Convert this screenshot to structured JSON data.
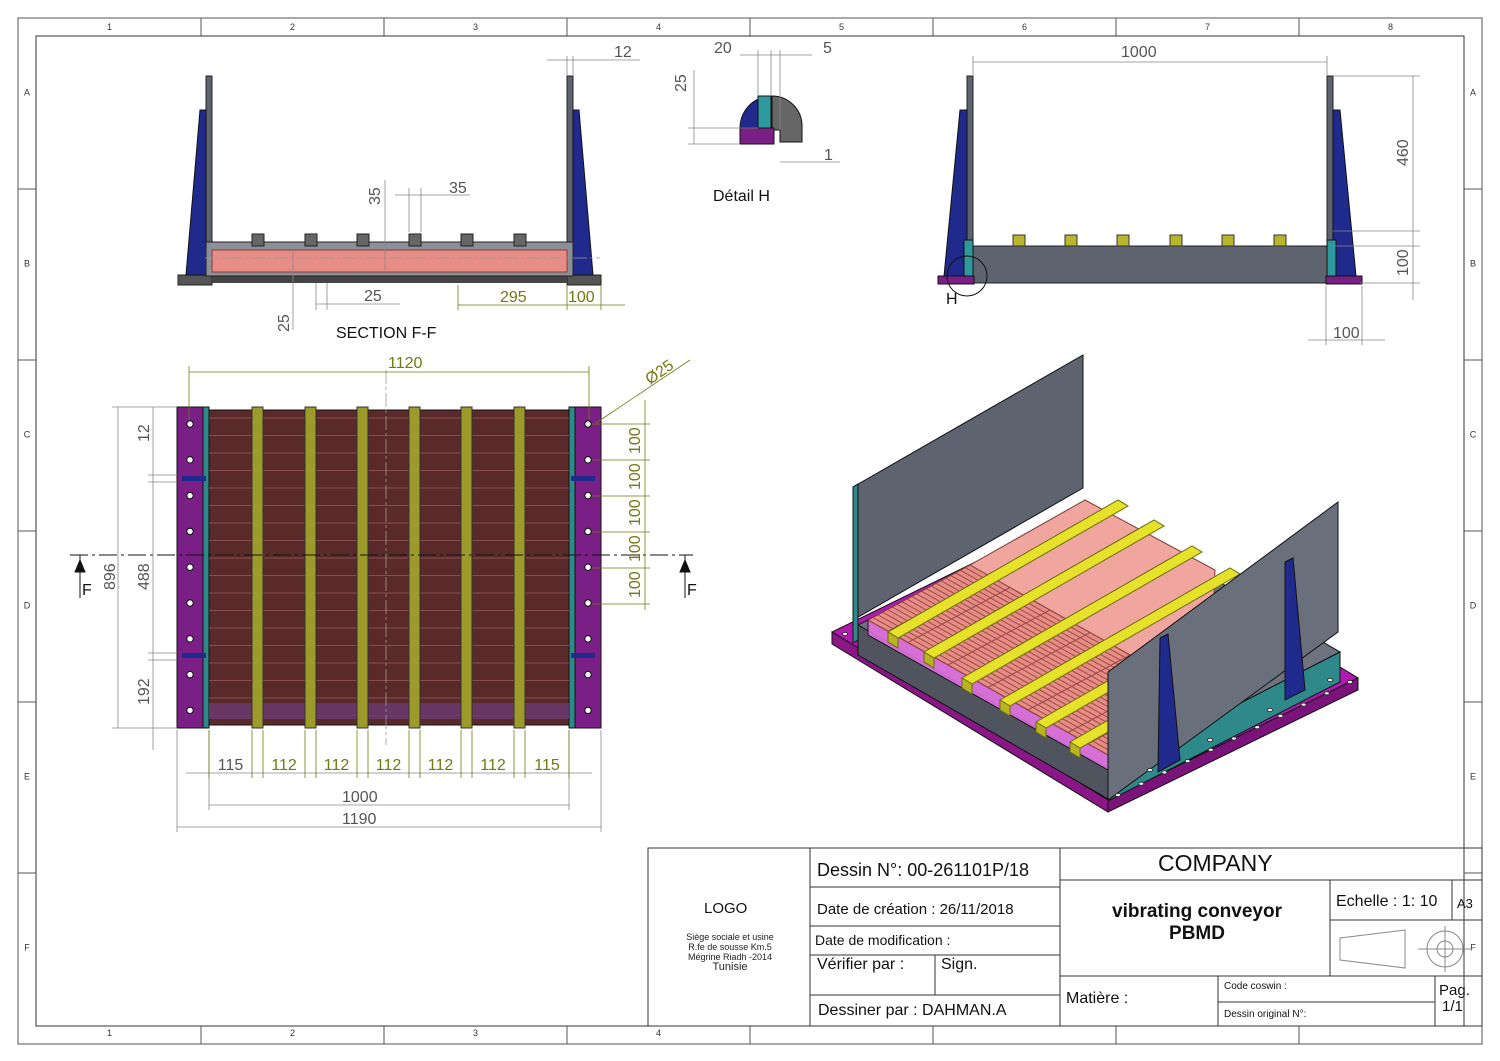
{
  "zones": {
    "columns": [
      "1",
      "2",
      "3",
      "4",
      "5",
      "6",
      "7",
      "8"
    ],
    "rows": [
      "A",
      "B",
      "C",
      "D",
      "E",
      "F"
    ]
  },
  "views": {
    "section_label": "SECTION F-F",
    "detail_label": "Détail H",
    "detail_marker": "H",
    "section_marker": "F"
  },
  "dimensions": {
    "section": {
      "d12": "12",
      "d35a": "35",
      "d35b": "35",
      "d25a": "25",
      "d25b": "25",
      "d295": "295",
      "d100": "100"
    },
    "detail": {
      "d20": "20",
      "d5": "5",
      "d25": "25",
      "d1": "1"
    },
    "side": {
      "d1000": "1000",
      "d460": "460",
      "d100a": "100",
      "d100b": "100"
    },
    "plan": {
      "d1120": "1120",
      "phi": "Ø25",
      "d12": "12",
      "d896": "896",
      "d488": "488",
      "d192": "192",
      "pitch": [
        "100",
        "100",
        "100",
        "100",
        "100"
      ],
      "bottom": [
        "115",
        "112",
        "112",
        "112",
        "112",
        "112",
        "115"
      ],
      "d1000": "1000",
      "d1190": "1190"
    }
  },
  "title_block": {
    "logo": "LOGO",
    "address": [
      "Siège sociale et usine",
      "R.fe de sousse Km.5",
      "Mégrine Riadh -2014",
      "Tunisie"
    ],
    "drawing_no": "Dessin N°: 00-261101P/18",
    "created": "Date de création : 26/11/2018",
    "modified": "Date de modification :",
    "verify": "Vérifier par :",
    "sign": "Sign.",
    "drawn_by": "Dessiner par : DAHMAN.A",
    "company": "COMPANY",
    "title_line1": "vibrating conveyor",
    "title_line2": "PBMD",
    "scale": "Echelle : 1: 10",
    "format": "A3",
    "material": "Matière :",
    "coswin": "Code coswin :",
    "original": "Dessin original N°:",
    "page_label": "Pag.",
    "page_value": "1/1"
  },
  "colors": {
    "blue_gusset": "#1f2a8c",
    "purple_plate": "#7a1f86",
    "magenta_iso": "#b01ab0",
    "salmon_tray": "#e88d86",
    "olive_bar": "#9c9a2a",
    "yellow_iso": "#e6e22a",
    "grey_wall": "#5e6370",
    "teal_strip": "#2e8a8a",
    "dim_grey": "#555555",
    "dim_olive": "#6f7a10"
  }
}
